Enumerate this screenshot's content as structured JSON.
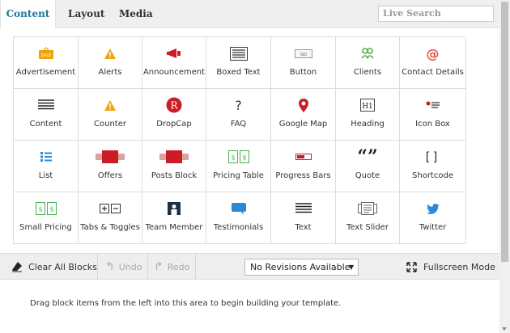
{
  "tabs": [
    {
      "label": "Content"
    },
    {
      "label": "Layout"
    },
    {
      "label": "Media"
    }
  ],
  "search": {
    "placeholder": "Live Search"
  },
  "blocks": [
    {
      "label": "Advertisement",
      "icon": "sale-tag-icon"
    },
    {
      "label": "Alerts",
      "icon": "warning-icon"
    },
    {
      "label": "Announcement",
      "icon": "megaphone-icon"
    },
    {
      "label": "Boxed Text",
      "icon": "boxed-lines-icon"
    },
    {
      "label": "Button",
      "icon": "go-button-icon"
    },
    {
      "label": "Clients",
      "icon": "users-icon"
    },
    {
      "label": "Contact Details",
      "icon": "at-sign-icon"
    },
    {
      "label": "Content",
      "icon": "text-lines-icon"
    },
    {
      "label": "Counter",
      "icon": "warning-icon"
    },
    {
      "label": "DropCap",
      "icon": "dropcap-r-icon"
    },
    {
      "label": "FAQ",
      "icon": "question-icon"
    },
    {
      "label": "Google Map",
      "icon": "map-pin-icon"
    },
    {
      "label": "Heading",
      "icon": "heading-h1-icon"
    },
    {
      "label": "Icon Box",
      "icon": "icon-box-icon"
    },
    {
      "label": "List",
      "icon": "list-icon"
    },
    {
      "label": "Offers",
      "icon": "ribbon-icon"
    },
    {
      "label": "Posts Block",
      "icon": "ribbon-icon"
    },
    {
      "label": "Pricing Table",
      "icon": "pricing-table-icon"
    },
    {
      "label": "Progress Bars",
      "icon": "progress-bar-icon"
    },
    {
      "label": "Quote",
      "icon": "quote-icon"
    },
    {
      "label": "Shortcode",
      "icon": "brackets-icon"
    },
    {
      "label": "Small Pricing",
      "icon": "pricing-table-icon"
    },
    {
      "label": "Tabs & Toggles",
      "icon": "plus-minus-icon"
    },
    {
      "label": "Team Member",
      "icon": "person-card-icon"
    },
    {
      "label": "Testimonials",
      "icon": "chat-bubble-icon"
    },
    {
      "label": "Text",
      "icon": "text-lines-icon"
    },
    {
      "label": "Text Slider",
      "icon": "slider-icon"
    },
    {
      "label": "Twitter",
      "icon": "twitter-bird-icon"
    }
  ],
  "toolbar": {
    "clear_label": "Clear All Blocks",
    "undo_label": "Undo",
    "redo_label": "Redo",
    "revisions_label": "No Revisions Available",
    "fullscreen_label": "Fullscreen Mode"
  },
  "canvas": {
    "hint": "Drag block items from the left into this area to begin building your template."
  },
  "colors": {
    "accent": "#21759b",
    "red": "#cc1d24",
    "orange": "#f0a30a",
    "blue": "#2b8ad8",
    "green": "#4caf50"
  }
}
